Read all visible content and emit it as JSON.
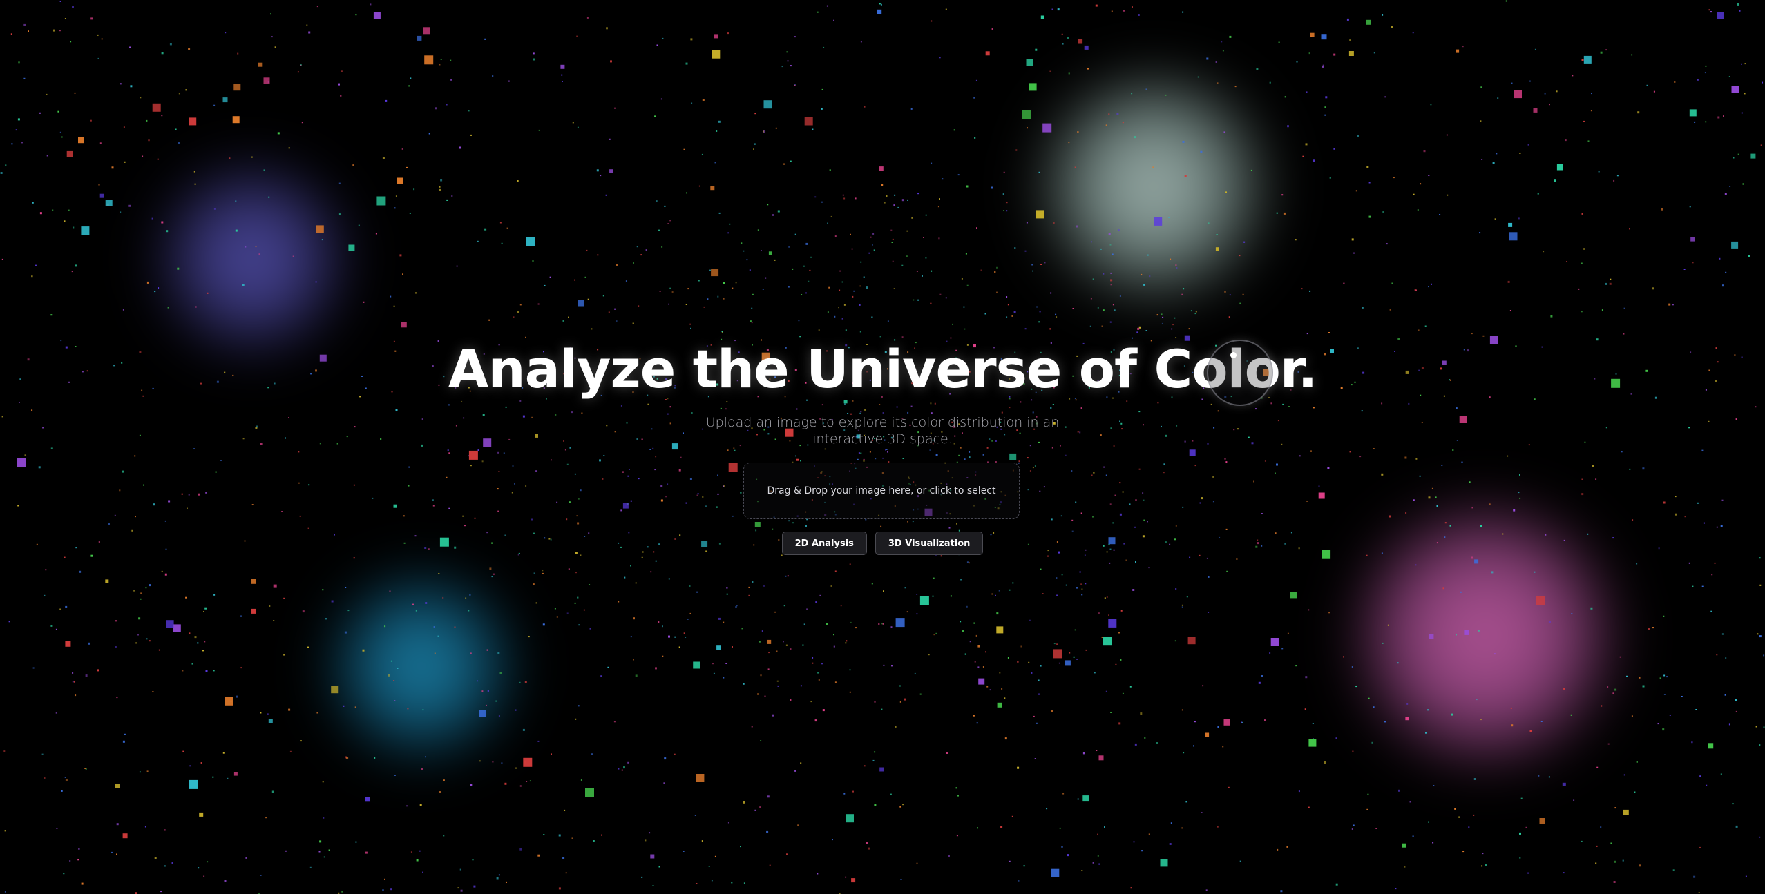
{
  "hero": {
    "title": "Analyze the Universe of Color.",
    "subtitle": "Upload an image to explore its color distribution in an interactive 3D space."
  },
  "dropzone": {
    "label": "Drag & Drop your image here, or click to select"
  },
  "modes": [
    {
      "label": "2D Analysis"
    },
    {
      "label": "3D Visualization"
    }
  ],
  "palette": {
    "background": "#000000",
    "particles": [
      "#e0408a",
      "#3a6fe0",
      "#2fb8c8",
      "#44c94a",
      "#d43c3c",
      "#9a4de0",
      "#c8b02a",
      "#e07a2a",
      "#2ad0a0",
      "#5a3ae0"
    ],
    "nebulae": [
      "#5250aa",
      "#aabeb9",
      "#1e8cb4",
      "#be5aa0"
    ]
  }
}
